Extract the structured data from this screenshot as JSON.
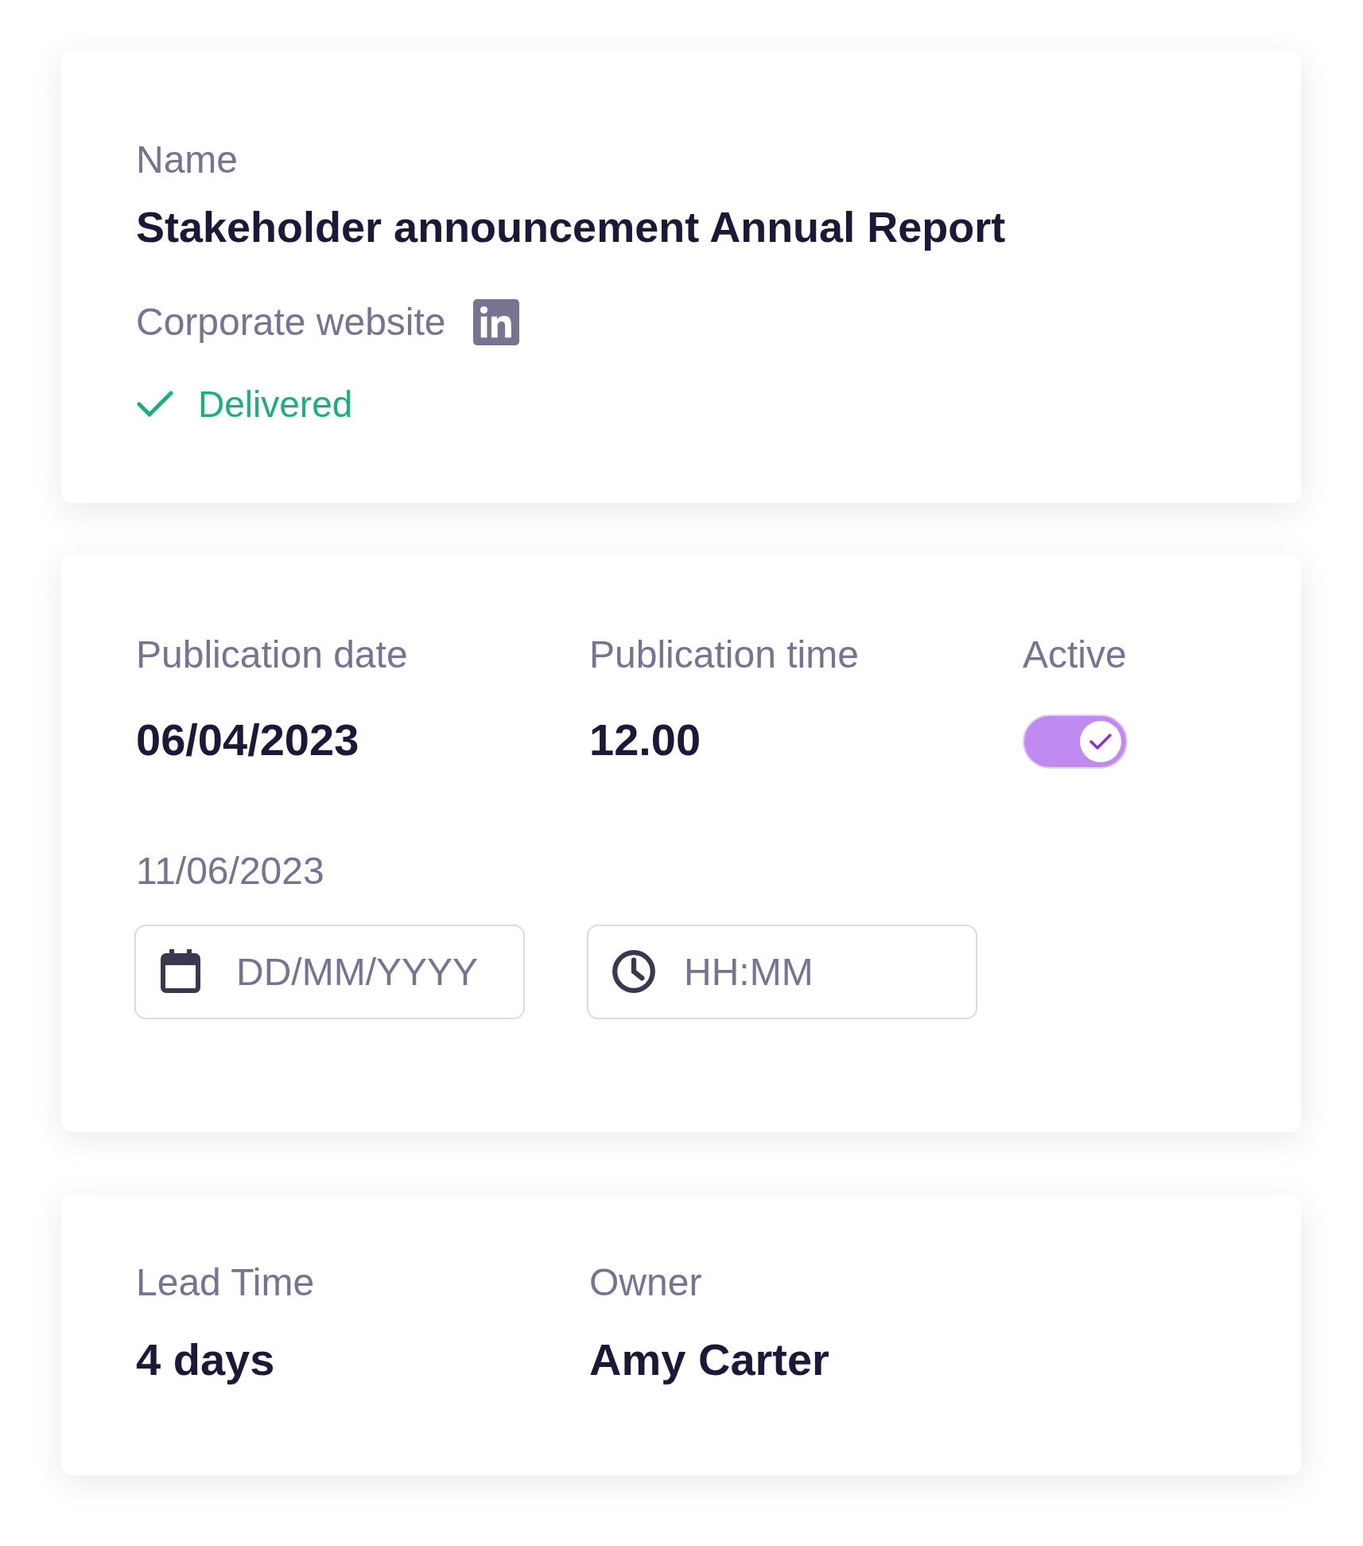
{
  "name": {
    "label": "Name",
    "value": "Stakeholder announcement Annual Report"
  },
  "channel": {
    "label": "Corporate website"
  },
  "status": {
    "label": "Delivered"
  },
  "schedule": {
    "publication_date": {
      "label": "Publication date",
      "value": "06/04/2023"
    },
    "publication_time": {
      "label": "Publication time",
      "value": "12.00"
    },
    "active": {
      "label": "Active",
      "on": true
    },
    "end_date": {
      "value": "11/06/2023"
    },
    "date_field": {
      "placeholder": "DD/MM/YYYY"
    },
    "time_field": {
      "placeholder": "HH:MM"
    }
  },
  "details": [
    {
      "label": "Lead Time",
      "value": "4 days"
    },
    {
      "label": "Owner",
      "value": "Amy Carter"
    }
  ]
}
